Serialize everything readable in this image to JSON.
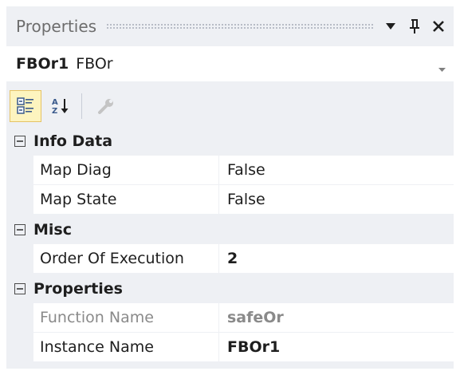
{
  "panel": {
    "title": "Properties",
    "buttons": [
      {
        "name": "dropdown-menu",
        "icon": "triangle-down-icon"
      },
      {
        "name": "pin",
        "icon": "pin-icon"
      },
      {
        "name": "close",
        "icon": "close-icon"
      }
    ]
  },
  "selector": {
    "object_name": "FBOr1",
    "object_type": "FBOr"
  },
  "toolbar": {
    "categorized": {
      "icon": "categorized-icon",
      "active": true
    },
    "alphabetical": {
      "icon": "sort-alphabetical-icon",
      "active": false
    },
    "property_pages": {
      "icon": "wrench-icon",
      "enabled": false
    }
  },
  "grid": {
    "categories": [
      {
        "label": "Info Data",
        "properties": [
          {
            "name": "Map Diag",
            "value": "False"
          },
          {
            "name": "Map State",
            "value": "False"
          }
        ]
      },
      {
        "label": "Misc",
        "properties": [
          {
            "name": "Order Of Execution",
            "value": "2"
          }
        ]
      },
      {
        "label": "Properties",
        "properties": [
          {
            "name": "Function Name",
            "value": "safeOr"
          },
          {
            "name": "Instance Name",
            "value": "FBOr1"
          }
        ]
      }
    ]
  },
  "colors": {
    "panel_background": "#eef0f4",
    "grid_background": "#ffffff",
    "active_tool": "#fdf4bf",
    "readonly_text": "#8a8a8a"
  }
}
